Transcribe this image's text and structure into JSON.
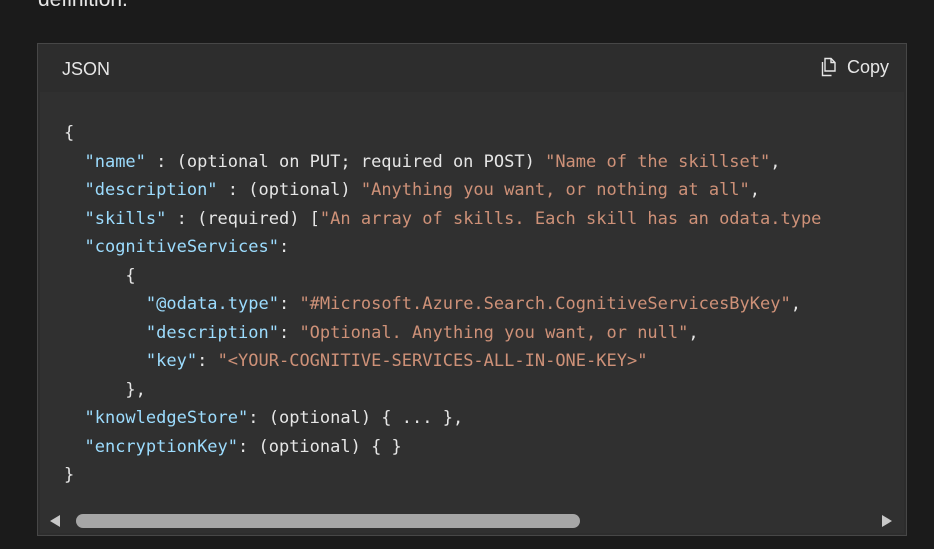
{
  "page": {
    "intro_text": "definition."
  },
  "code_block": {
    "language": "JSON",
    "copy_label": "Copy",
    "lines": [
      [
        {
          "t": "p",
          "v": "{"
        }
      ],
      [
        {
          "t": "p",
          "v": "  "
        },
        {
          "t": "k",
          "v": "\"name\""
        },
        {
          "t": "p",
          "v": " : (optional on PUT; required on POST) "
        },
        {
          "t": "s",
          "v": "\"Name of the skillset\""
        },
        {
          "t": "p",
          "v": ","
        }
      ],
      [
        {
          "t": "p",
          "v": "  "
        },
        {
          "t": "k",
          "v": "\"description\""
        },
        {
          "t": "p",
          "v": " : (optional) "
        },
        {
          "t": "s",
          "v": "\"Anything you want, or nothing at all\""
        },
        {
          "t": "p",
          "v": ","
        }
      ],
      [
        {
          "t": "p",
          "v": "  "
        },
        {
          "t": "k",
          "v": "\"skills\""
        },
        {
          "t": "p",
          "v": " : (required) ["
        },
        {
          "t": "s",
          "v": "\"An array of skills. Each skill has an odata.type"
        }
      ],
      [
        {
          "t": "p",
          "v": "  "
        },
        {
          "t": "k",
          "v": "\"cognitiveServices\""
        },
        {
          "t": "p",
          "v": ":"
        }
      ],
      [
        {
          "t": "p",
          "v": "      {"
        }
      ],
      [
        {
          "t": "p",
          "v": "        "
        },
        {
          "t": "k",
          "v": "\"@odata.type\""
        },
        {
          "t": "p",
          "v": ": "
        },
        {
          "t": "s",
          "v": "\"#Microsoft.Azure.Search.CognitiveServicesByKey\""
        },
        {
          "t": "p",
          "v": ","
        }
      ],
      [
        {
          "t": "p",
          "v": "        "
        },
        {
          "t": "k",
          "v": "\"description\""
        },
        {
          "t": "p",
          "v": ": "
        },
        {
          "t": "s",
          "v": "\"Optional. Anything you want, or null\""
        },
        {
          "t": "p",
          "v": ","
        }
      ],
      [
        {
          "t": "p",
          "v": "        "
        },
        {
          "t": "k",
          "v": "\"key\""
        },
        {
          "t": "p",
          "v": ": "
        },
        {
          "t": "s",
          "v": "\"<YOUR-COGNITIVE-SERVICES-ALL-IN-ONE-KEY>\""
        }
      ],
      [
        {
          "t": "p",
          "v": "      },"
        }
      ],
      [
        {
          "t": "p",
          "v": "  "
        },
        {
          "t": "k",
          "v": "\"knowledgeStore\""
        },
        {
          "t": "p",
          "v": ": (optional) { ... },"
        }
      ],
      [
        {
          "t": "p",
          "v": "  "
        },
        {
          "t": "k",
          "v": "\"encryptionKey\""
        },
        {
          "t": "p",
          "v": ": (optional) { }"
        }
      ],
      [
        {
          "t": "p",
          "v": "}"
        }
      ]
    ]
  },
  "scrollbar": {
    "thumb_fraction": 0.63
  },
  "colors": {
    "background": "#1b1b1b",
    "code_background": "#303030",
    "key": "#9cdcfe",
    "string": "#ce9178",
    "text": "#e6e6e6"
  },
  "icons": {
    "copy": "copy-icon"
  }
}
